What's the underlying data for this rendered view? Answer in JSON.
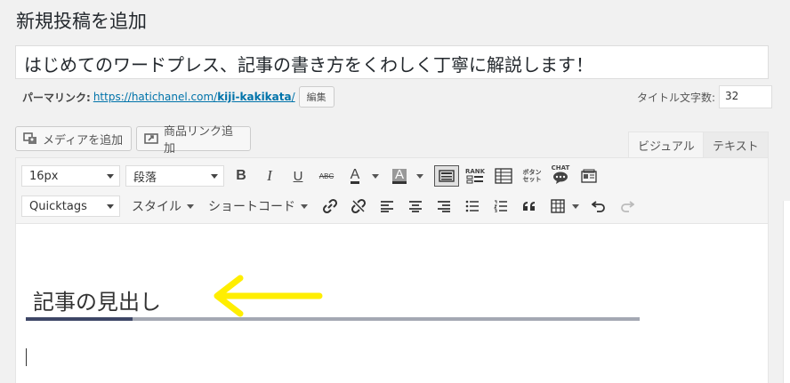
{
  "page": {
    "title": "新規投稿を追加"
  },
  "post": {
    "title": "はじめてのワードプレス、記事の書き方をくわしく丁寧に解説します！",
    "permalink_label": "パーマリンク:",
    "permalink_base": "https://hatichanel.com/",
    "permalink_slug": "kiji-kakikata",
    "permalink_suffix": "/",
    "edit_label": "編集",
    "title_count_label": "タイトル文字数:",
    "title_count_value": "32"
  },
  "media_buttons": {
    "add_media": "メディアを追加",
    "product_link": "商品リンク追加"
  },
  "tabs": {
    "visual": "ビジュアル",
    "text": "テキスト"
  },
  "toolbar": {
    "font_size": "16px",
    "format": "段落",
    "quicktags": "Quicktags",
    "style_menu": "スタイル",
    "shortcode_menu": "ショートコード",
    "icons": [
      "bold-icon",
      "italic-icon",
      "underline-icon",
      "strikethrough-icon",
      "text-color-icon",
      "background-color-icon",
      "toolbar-toggle-icon",
      "rank-icon",
      "table-icon",
      "button-set-icon",
      "chat-icon",
      "blog-card-icon",
      "link-icon",
      "unlink-icon",
      "align-left-icon",
      "align-center-icon",
      "align-right-icon",
      "bullet-list-icon",
      "numbered-list-icon",
      "blockquote-icon",
      "table-insert-icon",
      "undo-icon",
      "redo-icon"
    ],
    "labels": {
      "bold": "B",
      "italic": "I",
      "underline": "U",
      "strike": "ABC",
      "text_color": "A",
      "bg_color": "A",
      "rank": "RANK",
      "button_set_1": "ボタン",
      "button_set_2": "セット",
      "chat": "CHAT"
    }
  },
  "content": {
    "heading": "記事の見出し"
  },
  "colors": {
    "accent_link": "#0073aa",
    "heading_rule_dark": "#3d4666",
    "heading_rule_light": "#a4a8b3",
    "annotation_arrow": "#ffee00"
  }
}
